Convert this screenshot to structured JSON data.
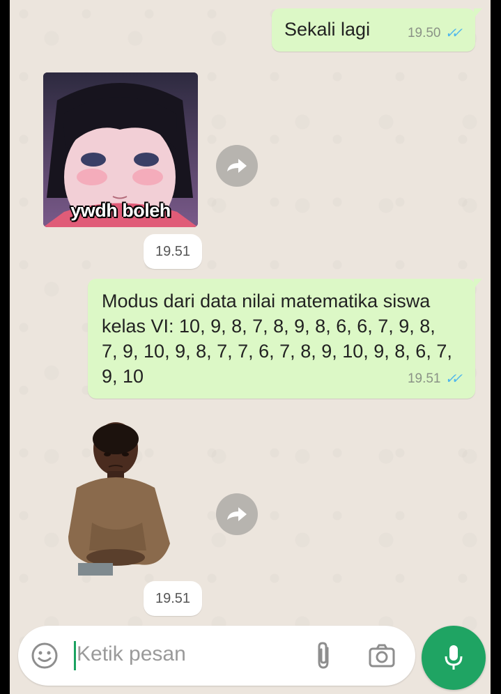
{
  "messages": [
    {
      "type": "outgoing",
      "text": "Sekali lagi",
      "time": "19.50",
      "status": "read"
    },
    {
      "type": "sticker",
      "caption": "ywdh boleh",
      "time": "19.51"
    },
    {
      "type": "outgoing",
      "text": "Modus dari data nilai matematika siswa kelas VI: 10, 9, 8, 7, 8, 9, 8, 6, 6, 7, 9, 8, 7, 9, 10, 9, 8, 7, 7, 6, 7, 8, 9, 10, 9, 8, 6, 7, 9, 10",
      "time": "19.51",
      "status": "read"
    },
    {
      "type": "sticker",
      "time": "19.51"
    }
  ],
  "composer": {
    "placeholder": "Ketik pesan",
    "icons": [
      "emoji-icon",
      "attach-icon",
      "camera-icon",
      "mic-icon"
    ]
  },
  "colors": {
    "outgoing_bubble": "#dcf8c6",
    "chat_background": "#ece5dd",
    "read_ticks": "#4fb6ec",
    "mic_button": "#1fa463"
  }
}
